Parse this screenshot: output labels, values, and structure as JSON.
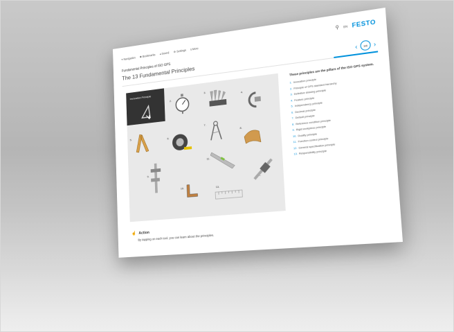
{
  "topbar": {
    "nav": [
      {
        "icon": "navigation-icon",
        "label": "Navigation"
      },
      {
        "icon": "bookmark-icon",
        "label": "Bookmarks"
      },
      {
        "icon": "sound-icon",
        "label": "Sound"
      },
      {
        "icon": "gear-icon",
        "label": "Settings"
      },
      {
        "icon": "info-icon",
        "label": "More"
      }
    ],
    "search_icon": "search-icon",
    "language": "EN",
    "logo": "FESTO"
  },
  "header": {
    "breadcrumb": "Fundamental Principles of ISO GPS",
    "title": "The 13 Fundamental Principles",
    "pager": {
      "prev": "‹",
      "page": "3/6",
      "next": "›"
    }
  },
  "tools": {
    "active_label": "Invocation Principle",
    "labels": [
      "2.",
      "3.",
      "4.",
      "5.",
      "6.",
      "7.",
      "8.",
      "9.",
      "10.",
      "11.",
      "12.",
      "13."
    ]
  },
  "side": {
    "heading": "These principles are the pillars of the ISO GPS system.",
    "items": [
      {
        "num": "1.",
        "label": "Invocation principle"
      },
      {
        "num": "2.",
        "label": "Principle of GPS standard hierarchy"
      },
      {
        "num": "3.",
        "label": "Definitive drawing principle"
      },
      {
        "num": "4.",
        "label": "Feature principle"
      },
      {
        "num": "5.",
        "label": "Independency principle"
      },
      {
        "num": "6.",
        "label": "Decimal principle"
      },
      {
        "num": "7.",
        "label": "Default principle"
      },
      {
        "num": "8.",
        "label": "Reference condition principle"
      },
      {
        "num": "9.",
        "label": "Rigid workpiece principle"
      },
      {
        "num": "10.",
        "label": "Duality principle"
      },
      {
        "num": "11.",
        "label": "Function control principle"
      },
      {
        "num": "12.",
        "label": "General specification principle"
      },
      {
        "num": "13.",
        "label": "Responsibility principle"
      }
    ]
  },
  "action": {
    "heading": "Action",
    "text": "By tapping on each tool, you can learn about the principles."
  },
  "colors": {
    "accent": "#0091dc",
    "tile_bg": "#e9e9e9",
    "active_tile": "#333333"
  }
}
